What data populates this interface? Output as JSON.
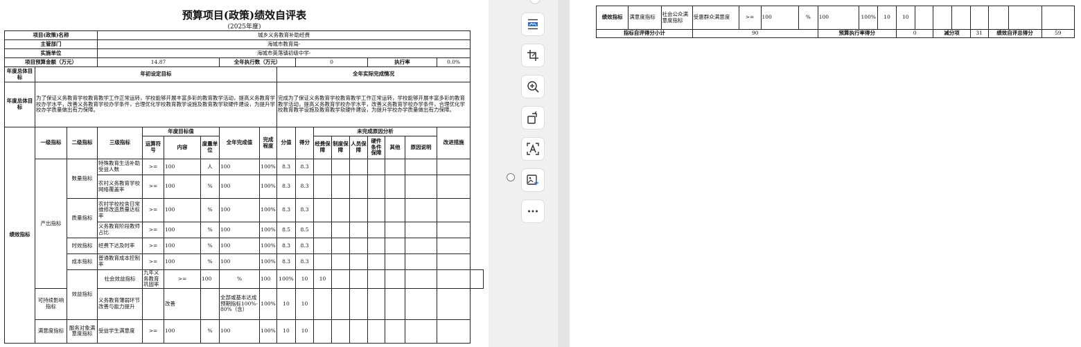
{
  "doc": {
    "title": "预算项目(政策)绩效自评表",
    "year": "(2025年度)",
    "labels": {
      "project_name": "项目(政策)名称",
      "department": "主管部门",
      "unit": "实施单位",
      "budget": "项目预算金额（万元）",
      "annual_exec": "全年执行数（万元）",
      "exec_rate": "执行率",
      "goal_overall": "年度总体目标",
      "initial_goal": "年初设定目标",
      "actual_done": "全年实际完成情况",
      "perf": "绩效指标",
      "lvl1": "一级指标",
      "lvl2": "二级指标",
      "lvl3": "三级指标",
      "target_group": "年度目标值",
      "op": "运算符号",
      "content": "内容",
      "unit_measure": "度量单位",
      "full_year": "全年完成值",
      "degree": "完成程度",
      "score_val": "分值",
      "score": "得分",
      "reason_group": "未完成原因分析",
      "r_fund": "经费保障",
      "r_system": "制度保障",
      "r_staff": "人员保障",
      "r_hw": "硬件条件保障",
      "r_other": "其他",
      "r_desc": "原因说明",
      "improve": "改进措施"
    },
    "values": {
      "project_name": "城乡义务教育补助经费",
      "department": "海城市教育局-",
      "unit": "海城市英落镇初级中学-",
      "budget": "14.87",
      "annual_exec": "0",
      "exec_rate": "0.0%",
      "goal_text": "为了保证义务教育学校教育教学工作正常运转，学校能够开展丰富多彩的教育教学活动，提高义务教育学校办学水平，改善义务教育学校办学条件，合理优化学校教育教学设施及教育教学软硬件建设，为提升学校办学质量做出有力保障。",
      "actual_text": "完成为了保证义务教育学校教育教学工作正常运转，学校能够开展丰富多彩的教育教学活动，提高义务教育学校办学水平，改善义务教育学校办学条件，合理优化学校教育教学设施及教育教学软硬件建设，为提升学校办学质量做出有力保障。"
    },
    "groups": {
      "output": "产出指标",
      "quantity": "数量指标",
      "quality": "质量指标",
      "timeliness": "时效指标",
      "cost": "成本指标",
      "benefit": "效益指标",
      "social": "社会效益指标",
      "sustain": "可持续影响指标",
      "satisfaction": "满意度指标",
      "service": "服务对象满意度指标"
    },
    "rows": [
      {
        "name": "特殊教育生活补助受益人数",
        "op": ">=",
        "content": "100",
        "unit": "人",
        "full": "100",
        "deg": "100%",
        "val": "8.3",
        "score": "8.3"
      },
      {
        "name": "农村义务教育学校网络覆盖率",
        "op": ">=",
        "content": "100",
        "unit": "%",
        "full": "100",
        "deg": "100%",
        "val": "8.3",
        "score": "8.3"
      },
      {
        "name": "农村学校校舍日常维修改造质量达标率",
        "op": ">=",
        "content": "100",
        "unit": "%",
        "full": "100",
        "deg": "100%",
        "val": "8.3",
        "score": "8.3"
      },
      {
        "name": "义务教育阶段教师占比",
        "op": ">=",
        "content": "100",
        "unit": "%",
        "full": "100",
        "deg": "100%",
        "val": "8.5",
        "score": "8.5"
      },
      {
        "name": "经费下达及时率",
        "op": ">=",
        "content": "100",
        "unit": "%",
        "full": "100",
        "deg": "100%",
        "val": "8.3",
        "score": "8.3"
      },
      {
        "name": "普通教育成本控制率",
        "op": ">=",
        "content": "100",
        "unit": "%",
        "full": "100",
        "deg": "100%",
        "val": "8.3",
        "score": "8.3"
      },
      {
        "name": "九年义务教育巩固率",
        "op": ">=",
        "content": "100",
        "unit": "%",
        "full": "100",
        "deg": "100%",
        "val": "10",
        "score": "10"
      },
      {
        "name": "义务教育薄弱环节改善与能力提升",
        "op": "",
        "content": "改善",
        "unit": "",
        "full": "全部或基本达成预期指标100%-80%（含）",
        "deg": "100%",
        "val": "10",
        "score": "10"
      },
      {
        "name": "受益学生满意度",
        "op": ">=",
        "content": "100",
        "unit": "%",
        "full": "100",
        "deg": "100%",
        "val": "10",
        "score": "10"
      }
    ]
  },
  "page2": {
    "row": {
      "l1": "绩效指标",
      "l2": "满意度指标",
      "l3": "社会公众满意度指标",
      "name": "受惠群众满意度",
      "op": ">=",
      "content": "100",
      "unit": "%",
      "full": "100",
      "deg": "100%",
      "val": "10",
      "score": "10"
    },
    "summary": {
      "self_label": "指标自评得分小计",
      "self_val": "90",
      "exec_label": "预算执行率得分",
      "exec_val": "0",
      "minus_label": "减分项",
      "minus_val": "31",
      "total_label": "绩效自评总得分",
      "total_val": "59"
    }
  },
  "toolbar": {
    "icons": [
      "page-layout-icon",
      "crop-icon",
      "zoom-in-icon",
      "rotate-icon",
      "text-recognize-icon",
      "image-ai-icon",
      "more-icon"
    ]
  }
}
